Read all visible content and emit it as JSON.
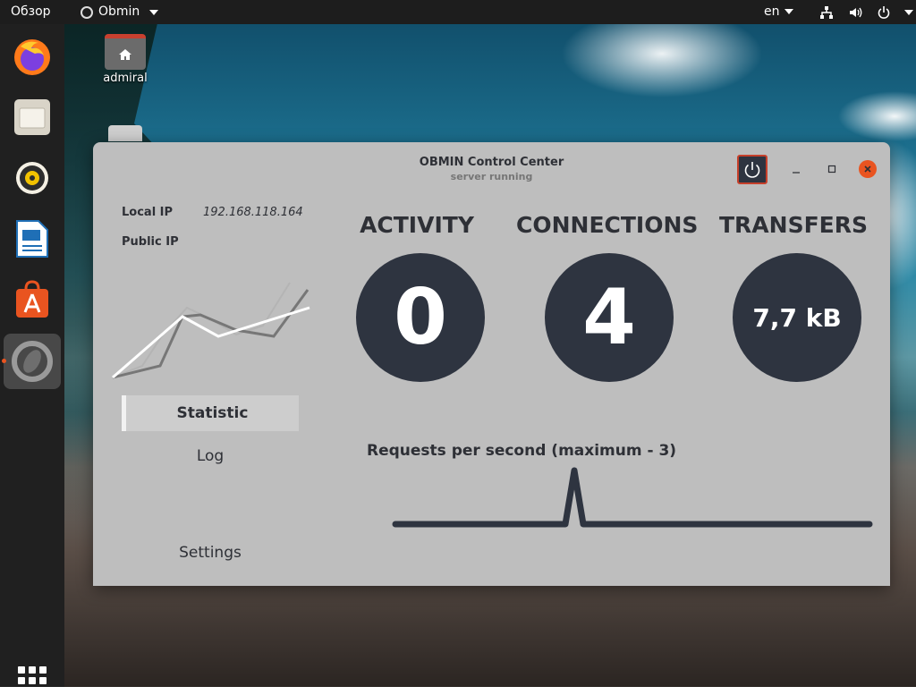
{
  "topbar": {
    "overview": "Обзор",
    "app_name": "Obmin",
    "language": "en"
  },
  "dock": {
    "items": [
      {
        "name": "firefox",
        "icon": "firefox-icon"
      },
      {
        "name": "files",
        "icon": "files-icon"
      },
      {
        "name": "rhythmbox",
        "icon": "speaker-icon"
      },
      {
        "name": "writer",
        "icon": "document-icon"
      },
      {
        "name": "software",
        "icon": "shopping-bag-icon"
      },
      {
        "name": "obmin",
        "icon": "obmin-icon",
        "active": true
      }
    ]
  },
  "desktop": {
    "home_label": "admiral"
  },
  "window": {
    "title": "OBMIN Control Center",
    "subtitle": "server running",
    "local_ip_label": "Local IP",
    "local_ip_value": "192.168.118.164",
    "public_ip_label": "Public IP",
    "public_ip_value": "",
    "nav": {
      "statistic": "Statistic",
      "log": "Log",
      "settings": "Settings"
    },
    "stats": {
      "activity_label": "ACTIVITY",
      "activity_value": "0",
      "connections_label": "CONNECTIONS",
      "connections_value": "4",
      "transfers_label": "TRANSFERS",
      "transfers_value": "7,7 kB"
    },
    "requests_label": "Requests per second (maximum - 3)",
    "requests_max": 3,
    "requests_series": [
      0,
      0,
      0,
      0,
      0,
      0,
      0,
      0,
      0,
      0,
      0,
      0,
      0,
      0,
      0,
      0,
      0,
      0,
      0,
      0,
      3,
      0,
      0,
      0,
      0,
      0,
      0,
      0,
      0,
      0,
      0,
      0,
      0,
      0,
      0,
      0,
      0,
      0,
      0,
      0,
      0,
      0,
      0,
      0,
      0,
      0,
      0,
      0,
      0,
      0,
      0,
      0,
      0,
      0
    ]
  },
  "colors": {
    "accent": "#e95420",
    "circle": "#2e3440",
    "window_bg": "#bebebe"
  }
}
